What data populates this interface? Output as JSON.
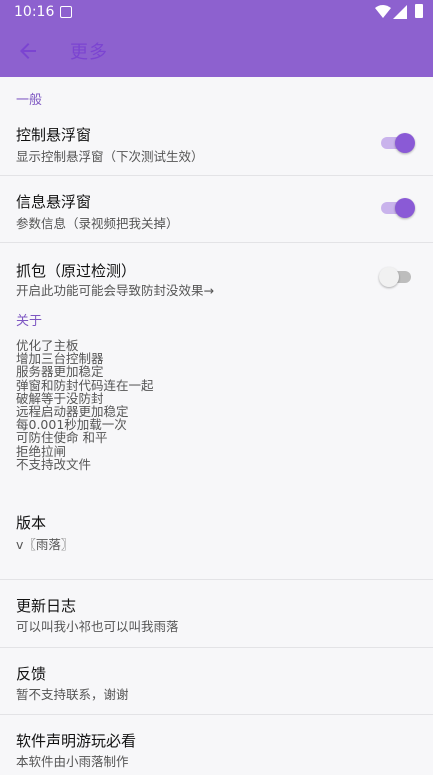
{
  "status_bar": {
    "time": "10:16"
  },
  "app_bar": {
    "title": "更多"
  },
  "sections": {
    "general": "一般",
    "about": "关于"
  },
  "settings": [
    {
      "title": "控制悬浮窗",
      "summary": "显示控制悬浮窗（下次测试生效）",
      "toggle": "on"
    },
    {
      "title": "信息悬浮窗",
      "summary": "参数信息（录视频把我关掉）",
      "toggle": "on"
    },
    {
      "title": "抓包（原过检测）",
      "summary": "开启此功能可能会导致防封没效果→",
      "toggle": "off"
    }
  ],
  "about_lines": [
    "优化了主板",
    "增加三台控制器",
    "服务器更加稳定",
    "弹窗和防封代码连在一起",
    "破解等于没防封",
    "远程启动器更加稳定",
    "每0.001秒加载一次",
    "可防住使命 和平",
    "拒绝拉闸",
    "不支持改文件"
  ],
  "info_rows": [
    {
      "title": "版本",
      "summary": "v〖雨落〗"
    },
    {
      "title": "更新日志",
      "summary": "可以叫我小祁也可以叫我雨落"
    },
    {
      "title": "反馈",
      "summary": "暂不支持联系，谢谢"
    },
    {
      "title": "软件声明游玩必看",
      "summary": "本软件由小雨落制作"
    }
  ],
  "colors": {
    "primary": "#8d61cf",
    "accent": "#8a5ad6",
    "section": "#7e57c2"
  }
}
